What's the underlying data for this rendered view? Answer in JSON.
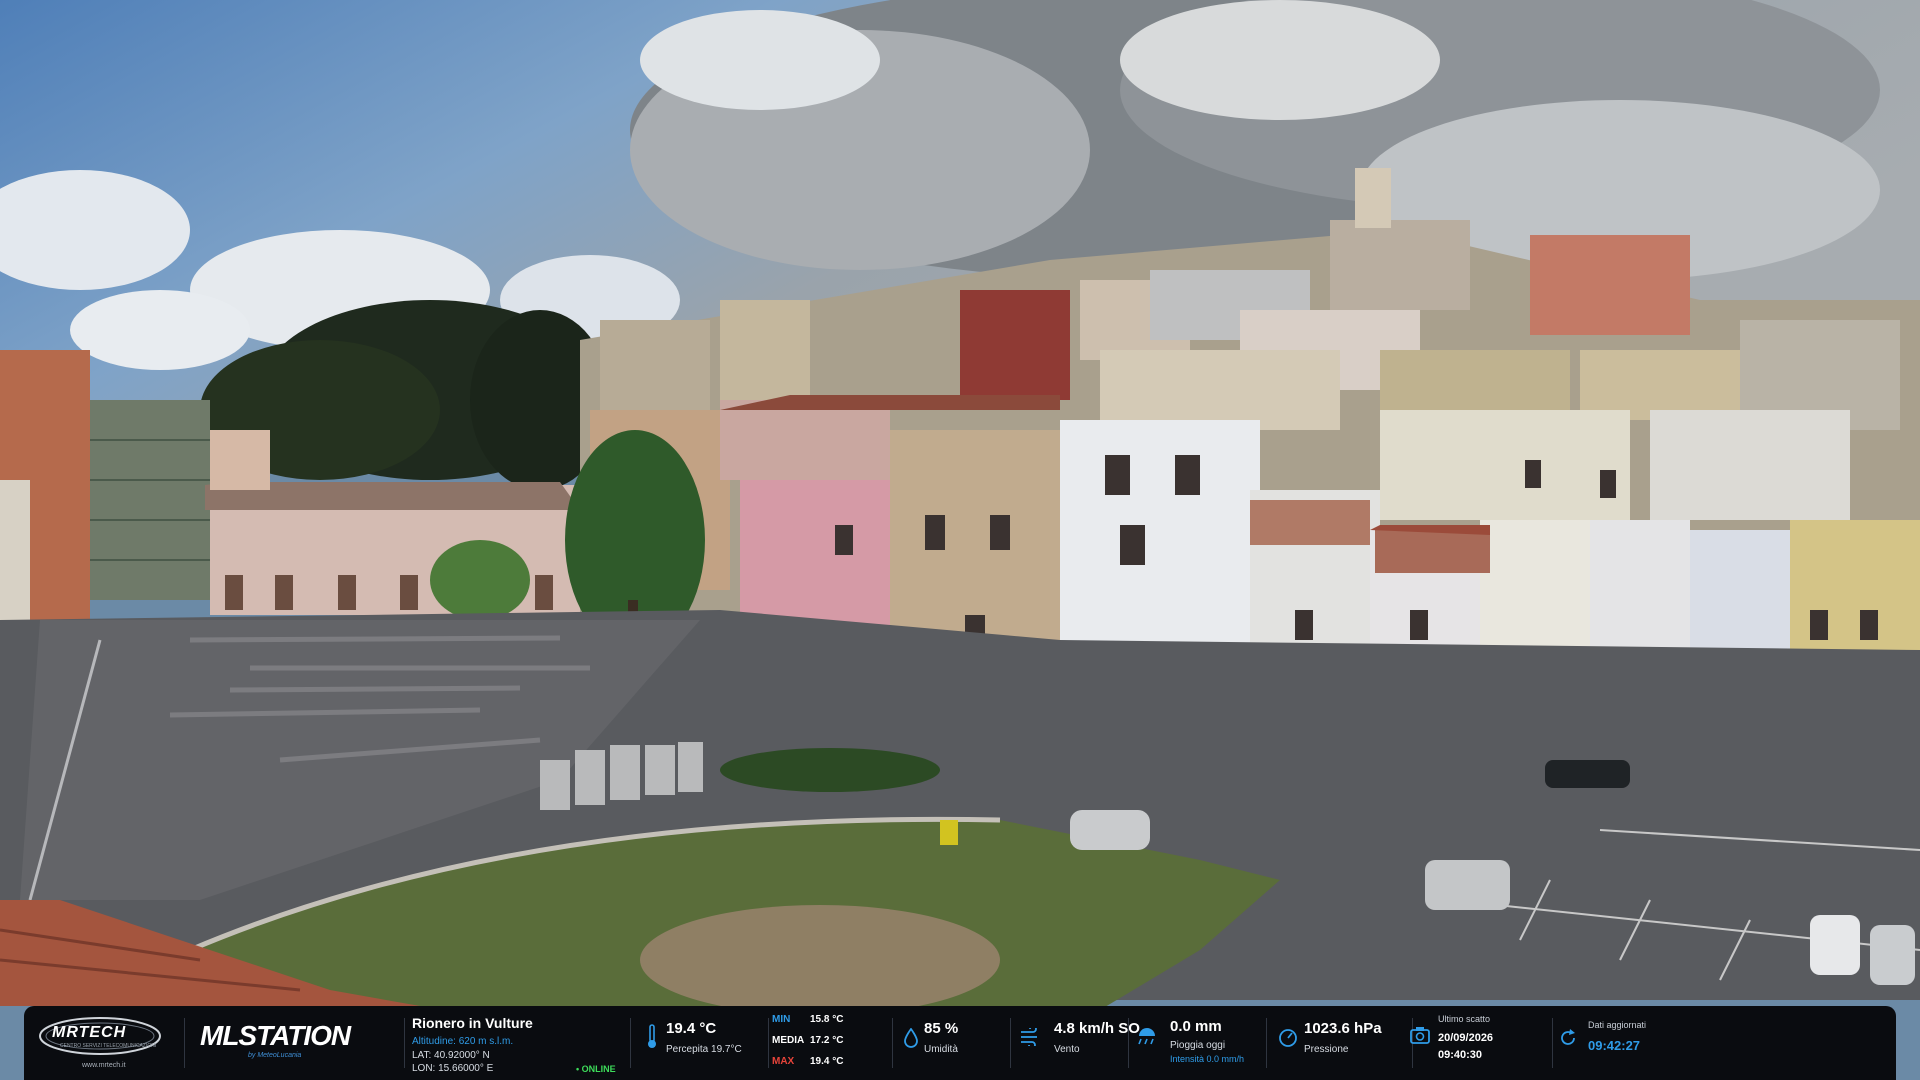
{
  "brand": {
    "logo_primary": "MRTECH",
    "logo_primary_sub": "CENTRO SERVIZI TELECOMUNICAZIONI",
    "logo_primary_url": "www.mrtech.it",
    "logo_secondary": "MLSTATION",
    "logo_secondary_by": "by MeteoLucania"
  },
  "station": {
    "name": "Rionero in Vulture",
    "altitude": "Altitudine: 620 m s.l.m.",
    "lat": "LAT: 40.92000° N",
    "lon": "LON: 15.66000° E",
    "status": "• ONLINE"
  },
  "temperature": {
    "value": "19.4 °C",
    "perceived": "Percepita 19.7°C",
    "min_label": "MIN",
    "min_value": "15.8 °C",
    "avg_label": "MEDIA",
    "avg_value": "17.2 °C",
    "max_label": "MAX",
    "max_value": "19.4 °C"
  },
  "humidity": {
    "value": "85 %",
    "label": "Umidità"
  },
  "wind": {
    "value": "4.8 km/h SO",
    "label": "Vento"
  },
  "rain": {
    "value": "0.0 mm",
    "label": "Pioggia oggi",
    "intensity": "Intensità 0.0 mm/h"
  },
  "pressure": {
    "value": "1023.6 hPa",
    "label": "Pressione"
  },
  "snapshot": {
    "label": "Ultimo scatto",
    "date": "20/09/2026",
    "time": "09:40:30"
  },
  "updated": {
    "label": "Dati aggiornati",
    "time": "09:42:27"
  },
  "colors": {
    "accent_blue": "#2f9ce8",
    "min_color": "#2f9ce8",
    "max_color": "#e8443a",
    "online_green": "#3ddc5a",
    "overlay_bg": "#0a0c10"
  },
  "icons": [
    "thermometer-icon",
    "droplet-icon",
    "wind-icon",
    "rain-icon",
    "gauge-icon",
    "camera-icon",
    "refresh-icon"
  ]
}
